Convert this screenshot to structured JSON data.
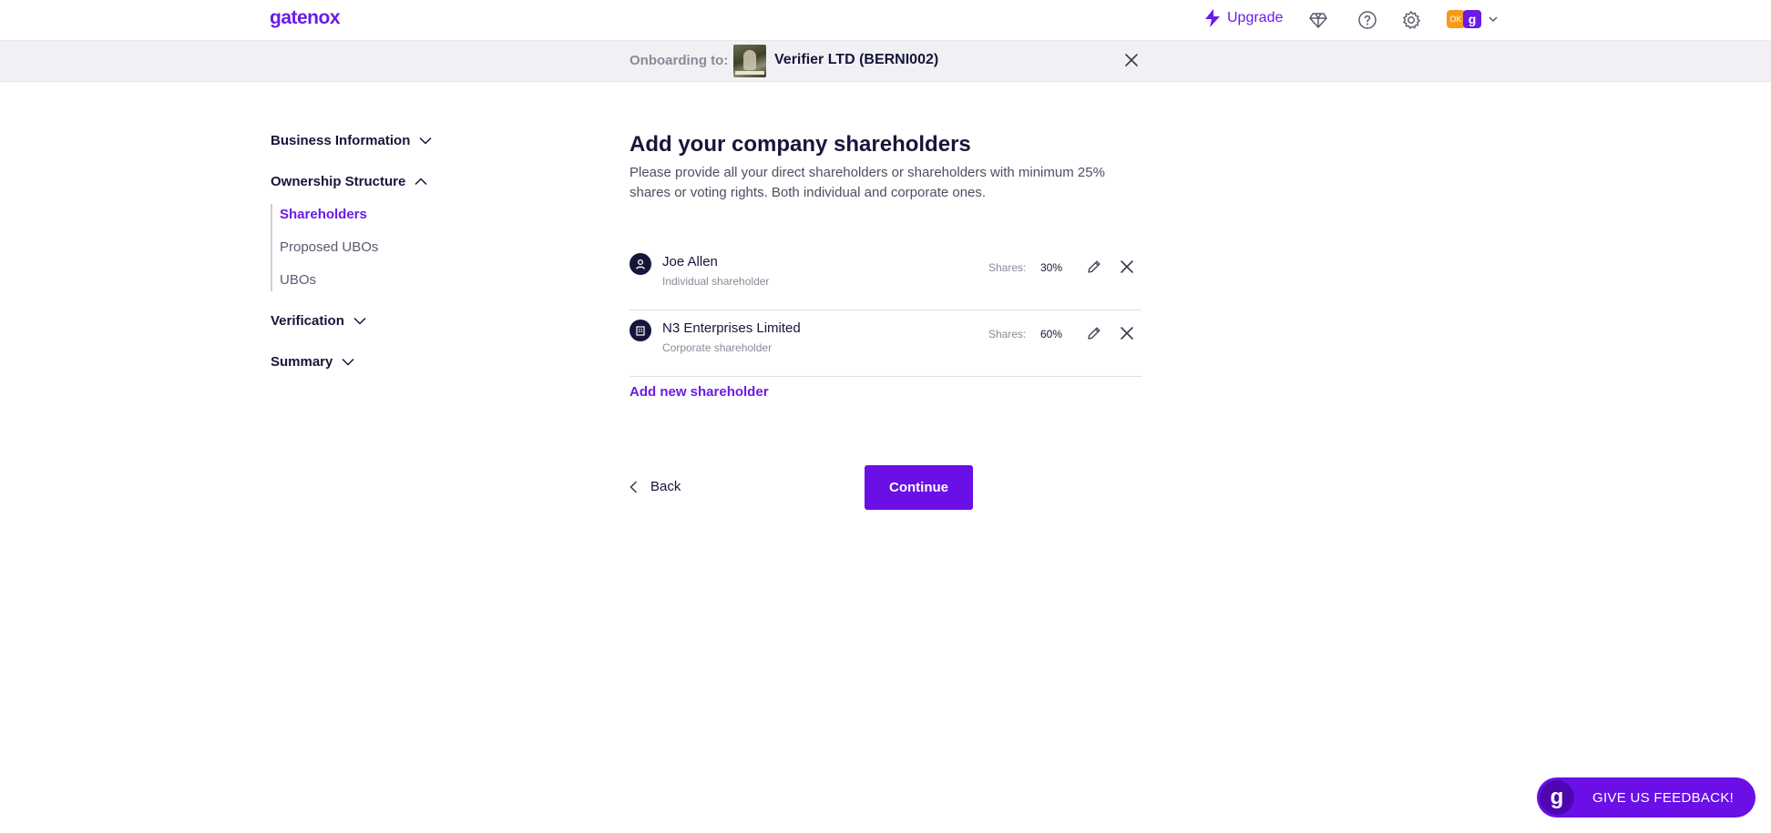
{
  "header": {
    "logo": "gatenox",
    "upgrade_label": "Upgrade",
    "avatar_initials": "OK",
    "avatar_brand": "g"
  },
  "onboarding": {
    "label": "Onboarding to:",
    "company": "Verifier LTD (BERNI002)"
  },
  "sidebar": {
    "sections": [
      {
        "label": "Business Information"
      },
      {
        "label": "Ownership Structure"
      },
      {
        "label": "Verification"
      },
      {
        "label": "Summary"
      }
    ],
    "sub_items": [
      {
        "label": "Shareholders"
      },
      {
        "label": "Proposed UBOs"
      },
      {
        "label": "UBOs"
      }
    ]
  },
  "main": {
    "title": "Add your company shareholders",
    "description": "Please provide all your direct shareholders or shareholders with minimum 25% shares or voting rights. Both individual and corporate ones.",
    "shareholders": [
      {
        "name": "Joe Allen",
        "type": "Individual shareholder",
        "shares_label": "Shares:",
        "shares": "30%"
      },
      {
        "name": "N3 Enterprises Limited",
        "type": "Corporate shareholder",
        "shares_label": "Shares:",
        "shares": "60%"
      }
    ],
    "add_label": "Add new shareholder",
    "back_label": "Back",
    "continue_label": "Continue"
  },
  "feedback": {
    "badge": "g",
    "label": "GIVE US FEEDBACK!"
  },
  "colors": {
    "accent": "#6a1be6",
    "text": "#16163a"
  }
}
